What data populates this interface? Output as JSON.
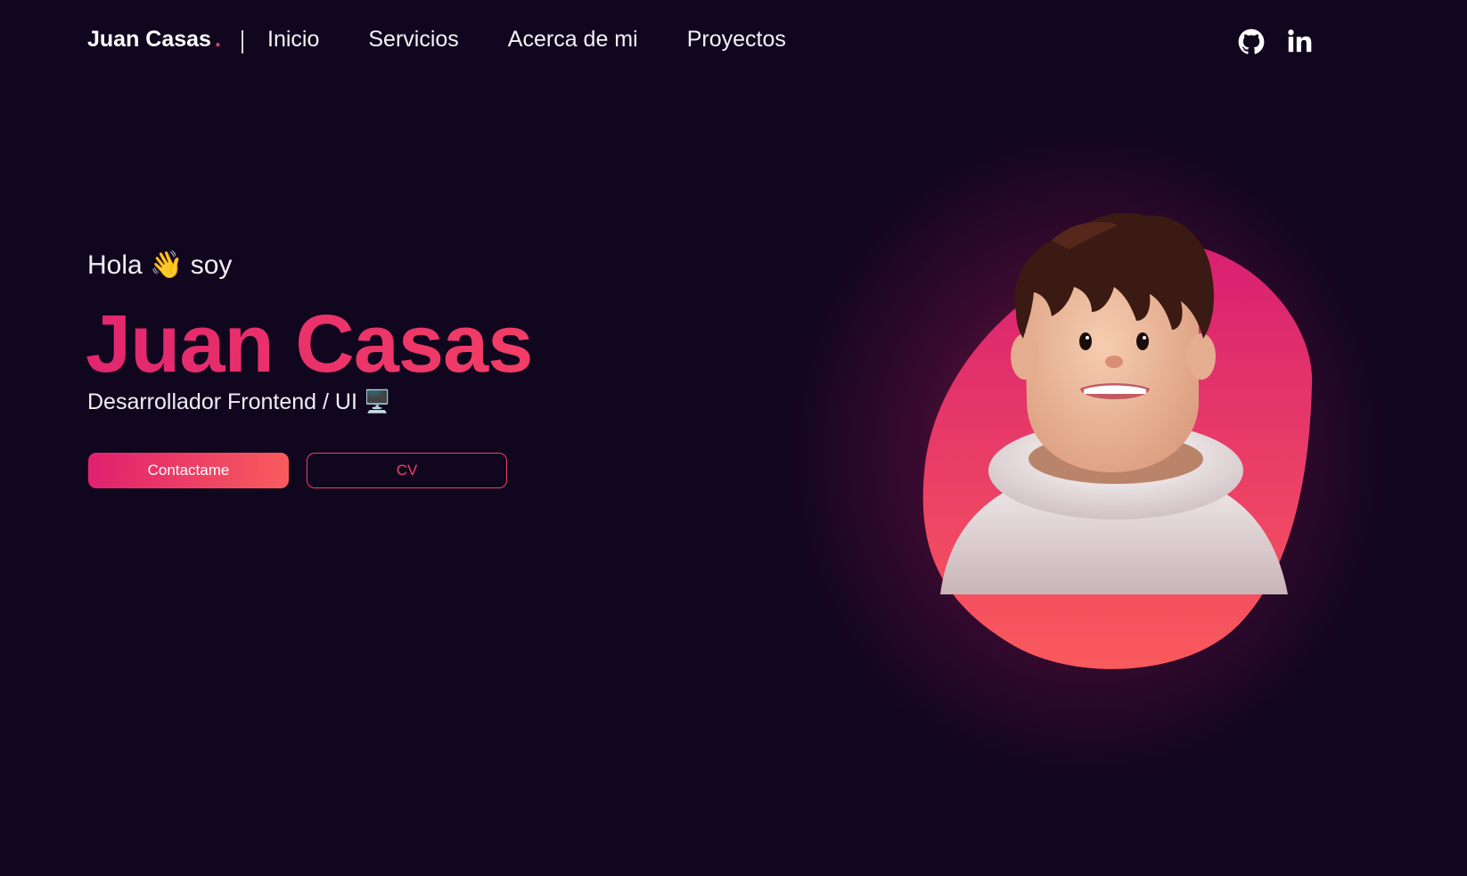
{
  "nav": {
    "brand": "Juan Casas",
    "brand_dot": ".",
    "links": [
      {
        "label": "Inicio"
      },
      {
        "label": "Servicios"
      },
      {
        "label": "Acerca de mi"
      },
      {
        "label": "Proyectos"
      }
    ],
    "social": [
      {
        "icon": "github-icon"
      },
      {
        "icon": "linkedin-icon"
      }
    ]
  },
  "hero": {
    "greeting": "Hola 👋 soy",
    "name": "Juan Casas",
    "role": "Desarrollador Frontend / UI 🖥️",
    "primary_button": "Contactame",
    "secondary_button": "CV"
  },
  "colors": {
    "background": "#10061e",
    "accent_start": "#e0216f",
    "accent_end": "#f85c5d",
    "accent": "#ee3e6c"
  }
}
